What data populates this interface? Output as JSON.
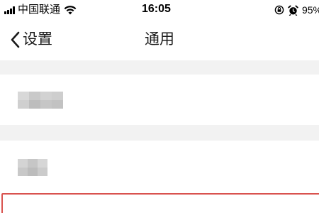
{
  "status_bar": {
    "carrier": "中国联通",
    "time": "16:05",
    "battery": "95%",
    "icons": [
      "signal-icon",
      "wifi-icon",
      "rotation-lock-icon",
      "alarm-icon"
    ]
  },
  "nav": {
    "back_label": "设置",
    "title": "通用"
  },
  "list": {
    "rows": [
      {
        "label_state": "blurred",
        "pixel_columns": 4
      },
      {
        "label_state": "blurred",
        "pixel_columns": 3
      }
    ],
    "highlighted_row_color": "#d9534f"
  },
  "colors": {
    "background": "#ffffff",
    "section_gap": "#f2f2f2",
    "text": "#1a1a1a"
  }
}
